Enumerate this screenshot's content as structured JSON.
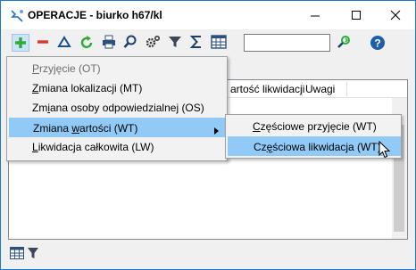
{
  "window": {
    "title": "OPERACJE - biurko h67/kl"
  },
  "toolbar": {
    "icons": [
      "add-icon",
      "remove-icon",
      "delta-icon",
      "refresh-icon",
      "print-icon",
      "search-icon",
      "settings-icon",
      "filter-icon",
      "sum-icon",
      "columns-icon",
      "find-next-icon",
      "help-icon"
    ],
    "search_value": ""
  },
  "grid": {
    "columns": [
      "artość likwidacji",
      "Uwagi"
    ]
  },
  "menu": {
    "items": [
      {
        "label": "Przyjęcie (OT)",
        "underline": "P",
        "rest": "rzyjęcie (OT)",
        "disabled": true
      },
      {
        "label": "Zmiana lokalizacji (MT)",
        "underline": "Z",
        "rest": "miana lokalizacji (MT)"
      },
      {
        "label": "Zmiana osoby odpowiedzialnej (OS)",
        "pre": "Zm",
        "underline": "i",
        "rest": "ana osoby odpowiedzialnej (OS)"
      },
      {
        "label": "Zmiana wartości (WT)",
        "pre": "Zmiana ",
        "underline": "w",
        "rest": "artości (WT)",
        "active": true
      },
      {
        "label": "Likwidacja całkowita (LW)",
        "underline": "L",
        "rest": "ikwidacja całkowita (LW)"
      }
    ]
  },
  "submenu": {
    "items": [
      {
        "label": "Częściowe przyjęcie (WT)",
        "underline": "C",
        "rest": "zęściowe przyjęcie (WT)"
      },
      {
        "label": "Częściowa likwidacja (WT)",
        "pre": "Cz",
        "underline": "ę",
        "rest": "ściowa likwidacja (WT)",
        "active": true
      }
    ]
  },
  "colors": {
    "accent": "#1979ca",
    "menu_highlight": "#91c9f7",
    "add_green": "#2eab3d",
    "remove_red": "#d9392b"
  }
}
